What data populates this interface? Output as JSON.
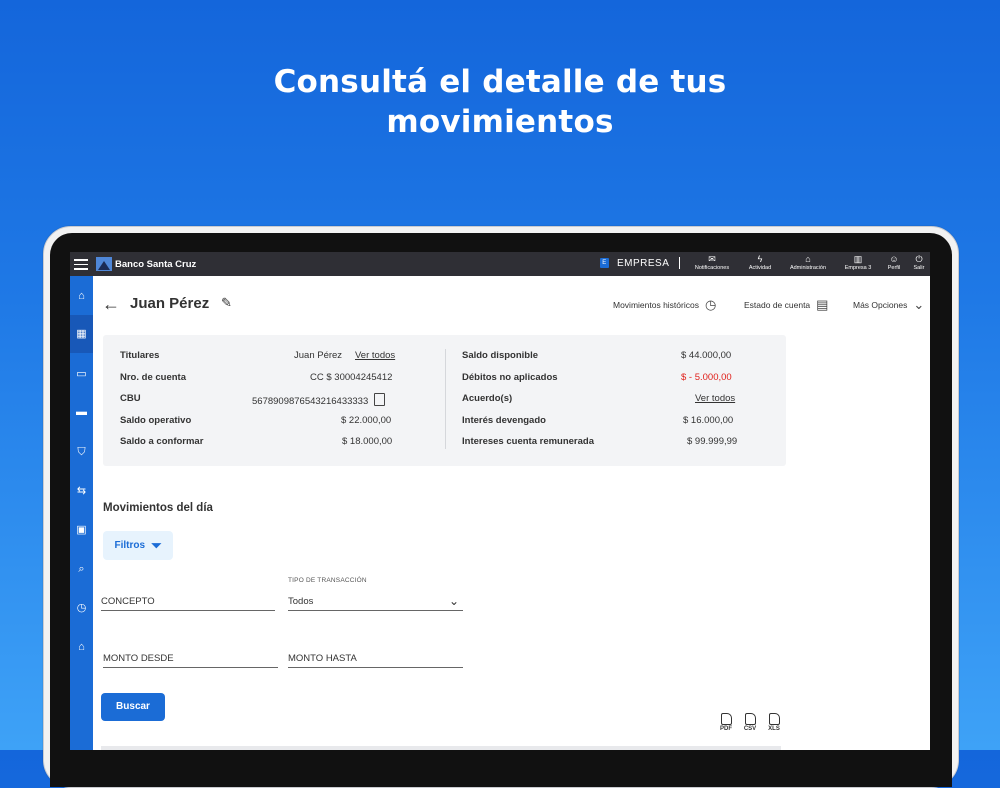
{
  "headline": {
    "line1": "Consultá el detalle de tus",
    "line2": "movimientos"
  },
  "topbar": {
    "brand": "Banco Santa Cruz",
    "company_badge": "E",
    "company": "EMPRESA",
    "items": [
      "Notificaciones",
      "Actividad",
      "Administración",
      "Empresa 3",
      "Perfil",
      "Salir"
    ]
  },
  "account": {
    "holder_name": "Juan Pérez",
    "actions": {
      "historic": "Movimientos históricos",
      "statement": "Estado de cuenta",
      "more": "Más Opciones"
    },
    "left": [
      {
        "label": "Titulares",
        "value": "Juan Pérez",
        "link": "Ver todos"
      },
      {
        "label": "Nro. de cuenta",
        "value": "CC $ 30004245412"
      },
      {
        "label": "CBU",
        "value": "5678909876543216433333"
      },
      {
        "label": "Saldo operativo",
        "value": "$ 22.000,00"
      },
      {
        "label": "Saldo a conformar",
        "value": "$ 18.000,00"
      }
    ],
    "right": [
      {
        "label": "Saldo disponible",
        "value": "$ 44.000,00"
      },
      {
        "label": "Débitos no aplicados",
        "value": "$ - 5.000,00"
      },
      {
        "label": "Acuerdo(s)",
        "value": "Ver todos"
      },
      {
        "label": "Interés devengado",
        "value": "$ 16.000,00"
      },
      {
        "label": "Intereses cuenta remunerada",
        "value": "$ 99.999,99"
      }
    ]
  },
  "movements": {
    "title": "Movimientos del día",
    "filters_label": "Filtros",
    "concept_label": "CONCEPTO",
    "type_label": "TIPO DE TRANSACCIÓN",
    "type_value": "Todos",
    "amount_from": "MONTO DESDE",
    "amount_to": "MONTO HASTA",
    "search_button": "Buscar",
    "downloads": [
      "PDF",
      "CSV",
      "XLS"
    ]
  },
  "colors": {
    "primary": "#1b6cd6",
    "negative": "#e0201b",
    "topbar": "#2f2f35"
  }
}
